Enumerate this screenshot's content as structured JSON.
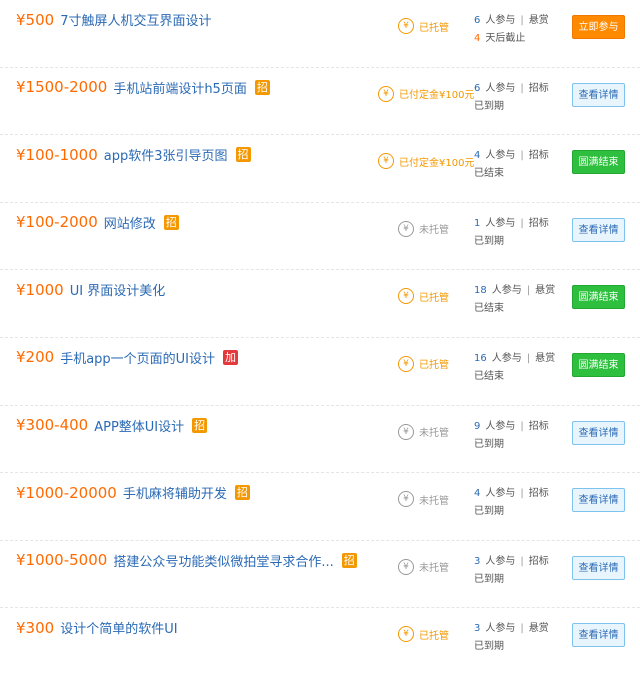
{
  "currency": "¥",
  "coin_icon": "yuan-coin-icon",
  "colors": {
    "price": "#ff6a00",
    "link": "#2b6ab5",
    "join_button": "#ff8a00",
    "done_button": "#2dbf3d",
    "view_button": "#e8f5fd"
  },
  "projects": [
    {
      "price": "500",
      "title": "7寸触屏人机交互界面设计",
      "tag": "",
      "tag_type": "",
      "status": "已托管",
      "status_grey": false,
      "status_long": false,
      "participants": "6",
      "participants_label": "人参与",
      "mode": "悬赏",
      "line2_highlight": "4",
      "line2_text": "天后截止",
      "button": "立即参与",
      "button_type": "join"
    },
    {
      "price": "1500-2000",
      "title": "手机站前端设计h5页面",
      "tag": "招",
      "tag_type": "recruit",
      "status": "已付定金¥100元",
      "status_grey": false,
      "status_long": true,
      "participants": "6",
      "participants_label": "人参与",
      "mode": "招标",
      "line2_highlight": "",
      "line2_text": "已到期",
      "button": "查看详情",
      "button_type": "view"
    },
    {
      "price": "100-1000",
      "title": "app软件3张引导页图",
      "tag": "招",
      "tag_type": "recruit",
      "status": "已付定金¥100元",
      "status_grey": false,
      "status_long": true,
      "participants": "4",
      "participants_label": "人参与",
      "mode": "招标",
      "line2_highlight": "",
      "line2_text": "已结束",
      "button": "圆满结束",
      "button_type": "done"
    },
    {
      "price": "100-2000",
      "title": "网站修改",
      "tag": "招",
      "tag_type": "recruit",
      "status": "未托管",
      "status_grey": true,
      "status_long": false,
      "participants": "1",
      "participants_label": "人参与",
      "mode": "招标",
      "line2_highlight": "",
      "line2_text": "已到期",
      "button": "查看详情",
      "button_type": "view"
    },
    {
      "price": "1000",
      "title": "UI 界面设计美化",
      "tag": "",
      "tag_type": "",
      "status": "已托管",
      "status_grey": false,
      "status_long": false,
      "participants": "18",
      "participants_label": "人参与",
      "mode": "悬赏",
      "line2_highlight": "",
      "line2_text": "已结束",
      "button": "圆满结束",
      "button_type": "done"
    },
    {
      "price": "200",
      "title": "手机app一个页面的UI设计",
      "tag": "加",
      "tag_type": "add",
      "status": "已托管",
      "status_grey": false,
      "status_long": false,
      "participants": "16",
      "participants_label": "人参与",
      "mode": "悬赏",
      "line2_highlight": "",
      "line2_text": "已结束",
      "button": "圆满结束",
      "button_type": "done"
    },
    {
      "price": "300-400",
      "title": "APP整体UI设计",
      "tag": "招",
      "tag_type": "recruit",
      "status": "未托管",
      "status_grey": true,
      "status_long": false,
      "participants": "9",
      "participants_label": "人参与",
      "mode": "招标",
      "line2_highlight": "",
      "line2_text": "已到期",
      "button": "查看详情",
      "button_type": "view"
    },
    {
      "price": "1000-20000",
      "title": "手机麻将辅助开发",
      "tag": "招",
      "tag_type": "recruit",
      "status": "未托管",
      "status_grey": true,
      "status_long": false,
      "participants": "4",
      "participants_label": "人参与",
      "mode": "招标",
      "line2_highlight": "",
      "line2_text": "已到期",
      "button": "查看详情",
      "button_type": "view"
    },
    {
      "price": "1000-5000",
      "title": "搭建公众号功能类似微拍堂寻求合作...",
      "tag": "招",
      "tag_type": "recruit",
      "status": "未托管",
      "status_grey": true,
      "status_long": false,
      "participants": "3",
      "participants_label": "人参与",
      "mode": "招标",
      "line2_highlight": "",
      "line2_text": "已到期",
      "button": "查看详情",
      "button_type": "view"
    },
    {
      "price": "300",
      "title": "设计个简单的软件UI",
      "tag": "",
      "tag_type": "",
      "status": "已托管",
      "status_grey": false,
      "status_long": false,
      "participants": "3",
      "participants_label": "人参与",
      "mode": "悬赏",
      "line2_highlight": "",
      "line2_text": "已到期",
      "button": "查看详情",
      "button_type": "view"
    }
  ]
}
